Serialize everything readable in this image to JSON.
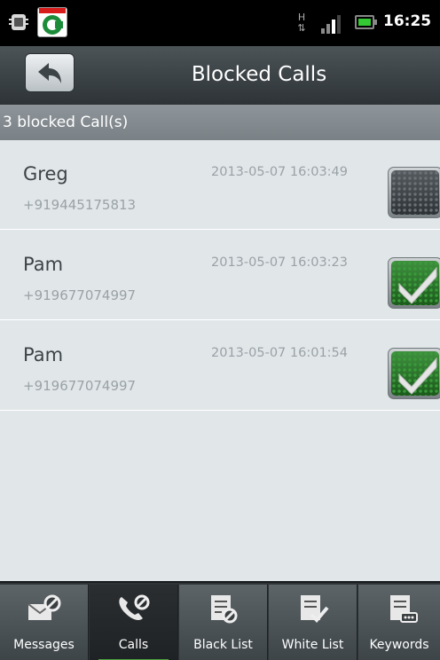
{
  "status_bar": {
    "time": "16:25",
    "network": "H",
    "icons": [
      "android-debug-icon",
      "comodo-app-icon",
      "network-h-icon",
      "signal-icon",
      "battery-icon"
    ]
  },
  "title_bar": {
    "title": "Blocked Calls",
    "back_icon": "back-arrow-icon"
  },
  "count_label": "3 blocked Call(s)",
  "calls": [
    {
      "name": "Greg",
      "number": "+919445175813",
      "time": "2013-05-07 16:03:49",
      "checked": false
    },
    {
      "name": "Pam",
      "number": "+919677074997",
      "time": "2013-05-07 16:03:23",
      "checked": true
    },
    {
      "name": "Pam",
      "number": "+919677074997",
      "time": "2013-05-07 16:01:54",
      "checked": true
    }
  ],
  "tabs": [
    {
      "label": "Messages",
      "icon": "message-block-icon",
      "active": false
    },
    {
      "label": "Calls",
      "icon": "phone-block-icon",
      "active": true
    },
    {
      "label": "Black List",
      "icon": "black-list-icon",
      "active": false
    },
    {
      "label": "White List",
      "icon": "white-list-icon",
      "active": false
    },
    {
      "label": "Keywords",
      "icon": "keywords-icon",
      "active": false
    }
  ],
  "colors": {
    "title_bar": "#3a4145",
    "list_background": "#e1e6e9",
    "check_on": "#2e7d2e",
    "active_tab_underline": "#4aa23e"
  }
}
